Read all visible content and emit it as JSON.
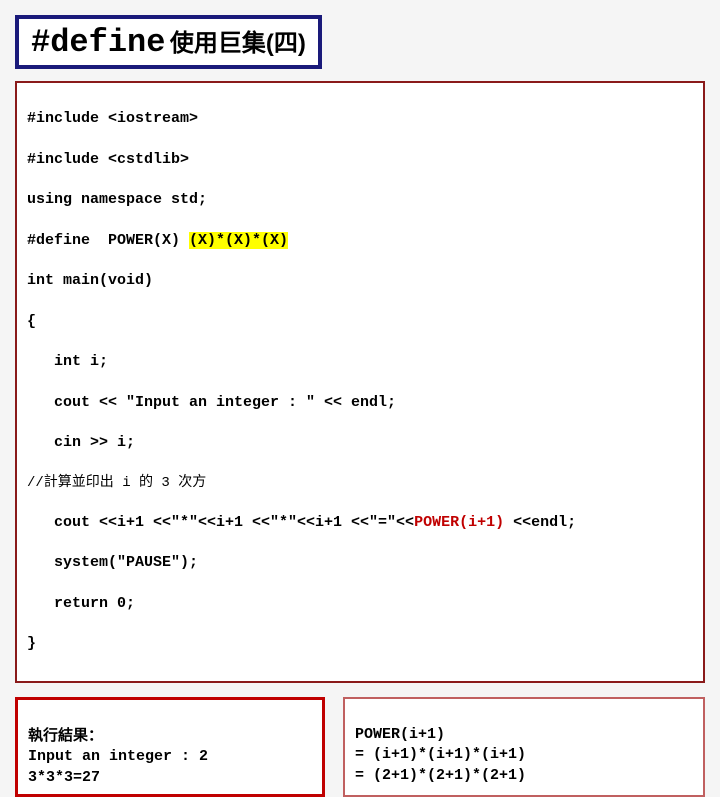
{
  "title": {
    "main": "#define",
    "sub": "使用巨集(四)"
  },
  "code": {
    "l1": "#include <iostream>",
    "l2": "#include <cstdlib>",
    "l3": "using namespace std;",
    "l4a": "#define  POWER(X) ",
    "l4b": "(X)*(X)*(X)",
    "l5": "int main(void)",
    "l6": "{",
    "l7": "   int i;",
    "l8": "   cout << \"Input an integer : \" << endl;",
    "l9": "   cin >> i;",
    "comment": "//計算並印出 i 的 3 次方",
    "l10a": "   cout <<i+1 <<\"*\"<<i+1 <<\"*\"<<i+1 <<\"=\"<<",
    "l10b": "POWER(i+1)",
    "l10c": " <<endl;",
    "l11": "   system(\"PAUSE\");",
    "l12": "   return 0;",
    "l13": "}"
  },
  "result": {
    "label": "執行結果：",
    "line1": "Input an integer : 2",
    "line2": "3*3*3=27"
  },
  "expand": {
    "l1": "POWER(i+1)",
    "l2": "= (i+1)*(i+1)*(i+1)",
    "l3": "= (2+1)*(2+1)*(2+1)"
  }
}
